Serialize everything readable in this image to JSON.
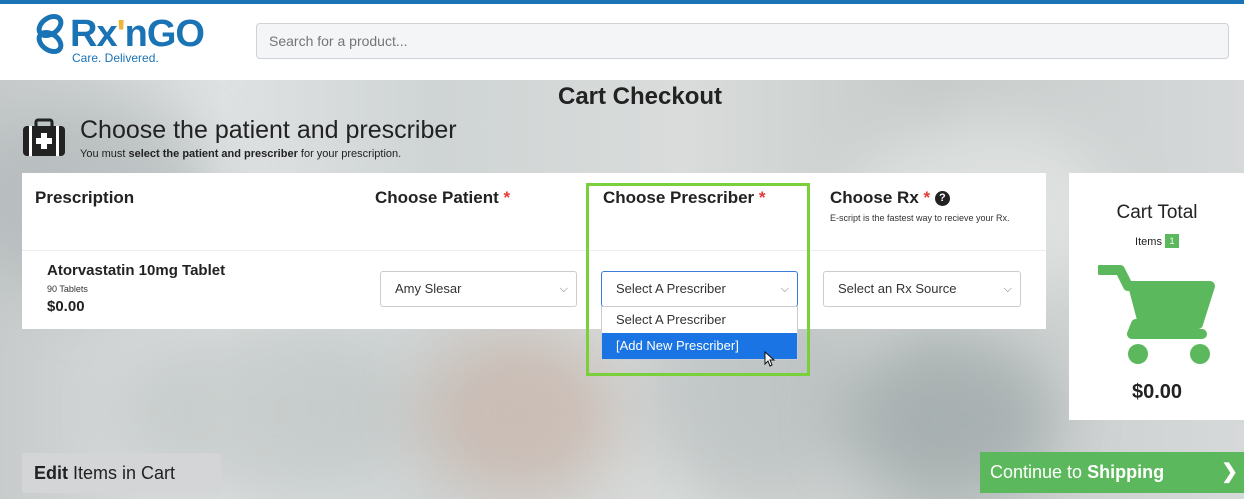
{
  "header": {
    "logo_text_a": "Rx",
    "logo_text_apos": "'",
    "logo_text_b": "nGO",
    "logo_tagline": "Care. Delivered.",
    "search_placeholder": "Search for a product..."
  },
  "page": {
    "title": "Cart Checkout",
    "section_title": "Choose the patient and prescriber",
    "section_sub_pre": "You must ",
    "section_sub_bold": "select the patient and prescriber",
    "section_sub_post": " for your prescription."
  },
  "columns": {
    "prescription": "Prescription",
    "patient": "Choose Patient",
    "prescriber": "Choose Prescriber",
    "rx": "Choose Rx",
    "required_mark": "*",
    "help_glyph": "?",
    "rx_note": "E-script is the fastest way to recieve your Rx."
  },
  "product": {
    "name": "Atorvastatin 10mg Tablet",
    "quantity": "90 Tablets",
    "price": "$0.00"
  },
  "selects": {
    "patient_value": "Amy Slesar",
    "prescriber_value": "Select A Prescriber",
    "rx_value": "Select an Rx Source",
    "chevron": "⌵"
  },
  "prescriber_dropdown": {
    "options": [
      "Select A Prescriber",
      "[Add New Prescriber]"
    ],
    "highlighted_index": 1
  },
  "cart": {
    "title": "Cart Total",
    "items_label": "Items",
    "items_count": "1",
    "total": "$0.00"
  },
  "footer": {
    "edit_bold": "Edit",
    "edit_rest": " Items in Cart",
    "continue_pre": "Continue to ",
    "continue_bold": "Shipping",
    "continue_arrow": "❯"
  },
  "colors": {
    "brand_blue": "#1a73b5",
    "accent_green": "#5cb85c",
    "highlight_green": "#7ad03a",
    "required_red": "#e53935",
    "selected_blue": "#1a74e3"
  }
}
